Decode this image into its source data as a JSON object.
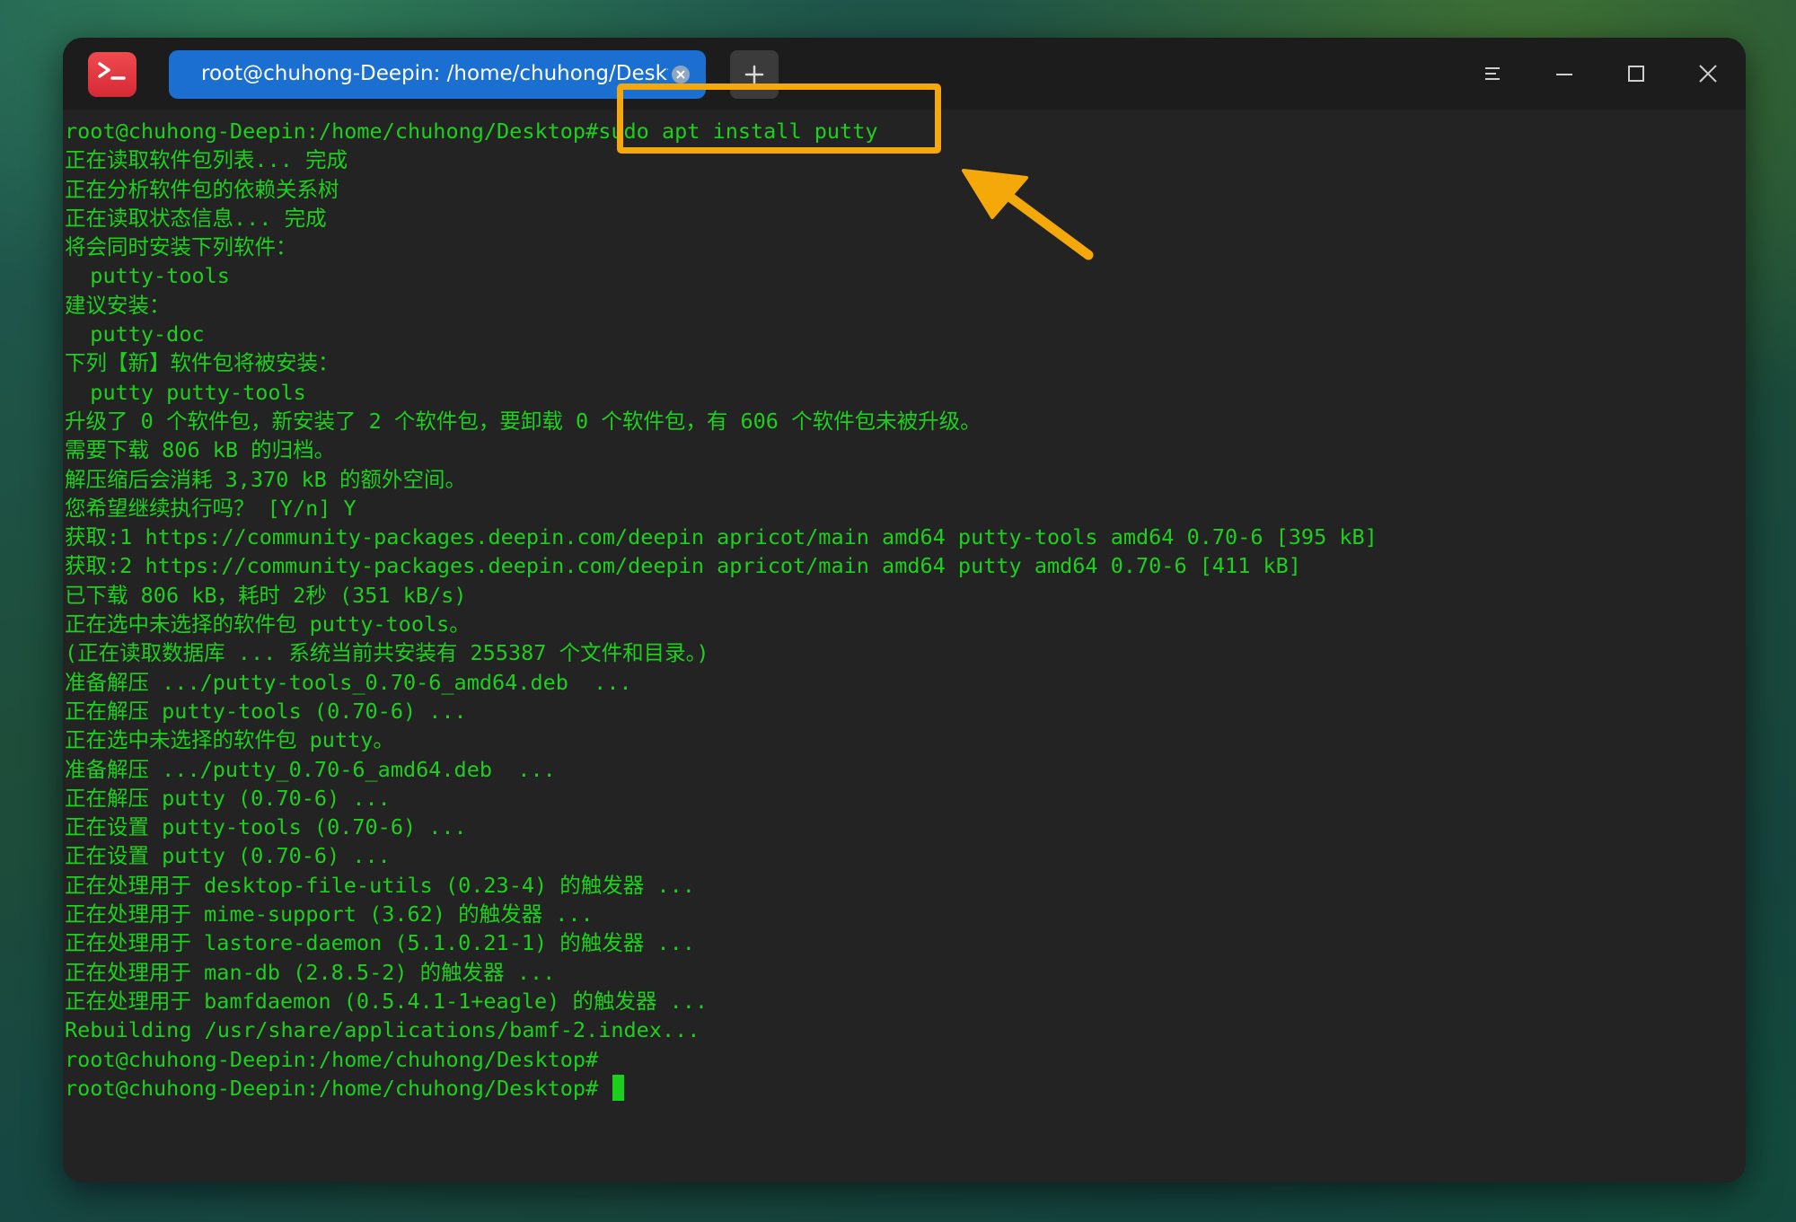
{
  "window": {
    "tab_title": "root@chuhong-Deepin: /home/chuhong/Desktop",
    "icons": {
      "app": "terminal-app-icon",
      "close_tab": "close-icon",
      "new_tab": "plus-icon",
      "menu": "menu-icon",
      "minimize": "minimize-icon",
      "maximize": "maximize-icon",
      "close": "close-icon"
    }
  },
  "terminal": {
    "prompt": "root@chuhong-Deepin:/home/chuhong/Desktop#",
    "command": "sudo apt install putty",
    "lines": [
      "正在读取软件包列表... 完成",
      "正在分析软件包的依赖关系树",
      "正在读取状态信息... 完成",
      "将会同时安装下列软件：",
      "  putty-tools",
      "建议安装：",
      "  putty-doc",
      "下列【新】软件包将被安装：",
      "  putty putty-tools",
      "升级了 0 个软件包，新安装了 2 个软件包，要卸载 0 个软件包，有 606 个软件包未被升级。",
      "需要下载 806 kB 的归档。",
      "解压缩后会消耗 3,370 kB 的额外空间。",
      "您希望继续执行吗？ [Y/n] Y",
      "获取:1 https://community-packages.deepin.com/deepin apricot/main amd64 putty-tools amd64 0.70-6 [395 kB]",
      "获取:2 https://community-packages.deepin.com/deepin apricot/main amd64 putty amd64 0.70-6 [411 kB]",
      "已下载 806 kB，耗时 2秒 (351 kB/s)",
      "正在选中未选择的软件包 putty-tools。",
      "(正在读取数据库 ... 系统当前共安装有 255387 个文件和目录。)",
      "准备解压 .../putty-tools_0.70-6_amd64.deb  ...",
      "正在解压 putty-tools (0.70-6) ...",
      "正在选中未选择的软件包 putty。",
      "准备解压 .../putty_0.70-6_amd64.deb  ...",
      "正在解压 putty (0.70-6) ...",
      "正在设置 putty-tools (0.70-6) ...",
      "正在设置 putty (0.70-6) ...",
      "正在处理用于 desktop-file-utils (0.23-4) 的触发器 ...",
      "正在处理用于 mime-support (3.62) 的触发器 ...",
      "正在处理用于 lastore-daemon (5.1.0.21-1) 的触发器 ...",
      "正在处理用于 man-db (2.8.5-2) 的触发器 ...",
      "正在处理用于 bamfdaemon (0.5.4.1-1+eagle) 的触发器 ...",
      "Rebuilding /usr/share/applications/bamf-2.index..."
    ],
    "final_prompts": [
      "root@chuhong-Deepin:/home/chuhong/Desktop#",
      "root@chuhong-Deepin:/home/chuhong/Desktop# "
    ]
  },
  "annotation": {
    "color": "#f5a809",
    "arrow_icon": "arrow-icon"
  },
  "colors": {
    "terminal_text": "#1ed01e",
    "terminal_bg": "#232323",
    "tab_active": "#1a6fd1"
  }
}
